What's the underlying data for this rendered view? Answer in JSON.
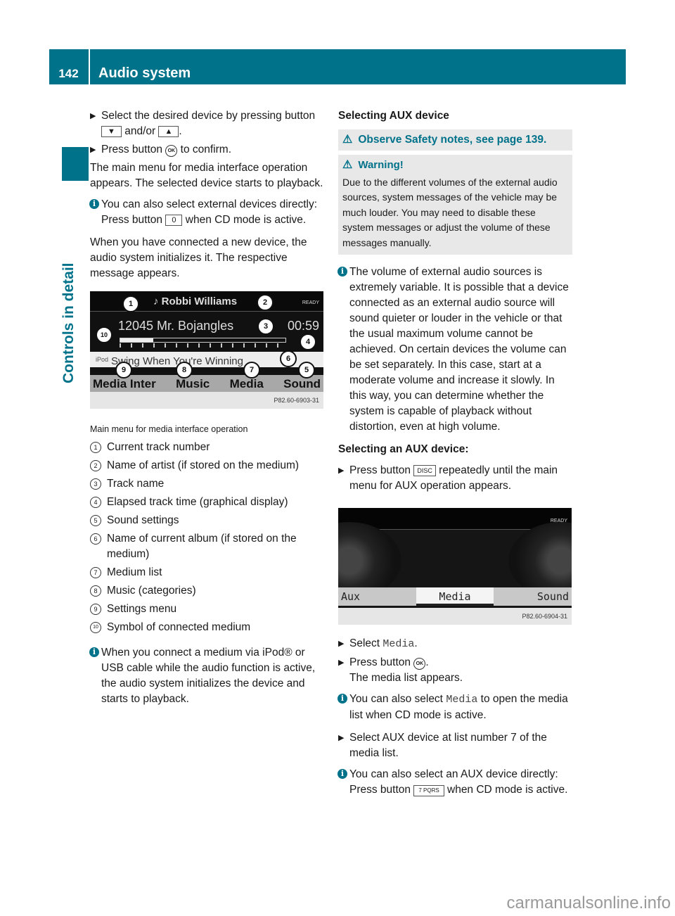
{
  "header": {
    "page_number": "142",
    "title": "Audio system"
  },
  "sidebar": {
    "section": "Controls in detail"
  },
  "left": {
    "steps_1": [
      {
        "pre": "Select the desired device by pressing button",
        "key1": "▼",
        "mid": "and/or",
        "key2": "▲",
        "post": "."
      },
      {
        "pre": "Press button",
        "key": "OK",
        "post": "to confirm."
      }
    ],
    "para_1": "The main menu for media interface operation appears. The selected device starts to playback.",
    "info_1": {
      "pre": "You can also select external devices directly: Press button",
      "key": "0",
      "post": "when CD mode is active."
    },
    "para_2": "When you have connected a new device, the audio system initializes it. The respective message appears.",
    "figure": {
      "artist": "Robbi Williams",
      "ready_label": "READY",
      "track": "12045  Mr. Bojangles",
      "time": "00:59",
      "progress_fraction": 0.2,
      "source": "iPod",
      "album": "Swing When You're Winning",
      "menu": [
        "Media Inter",
        "Music",
        "Media",
        "Sound"
      ],
      "code": "P82.60-6903-31",
      "callouts": [
        "1",
        "2",
        "3",
        "4",
        "5",
        "6",
        "7",
        "8",
        "9",
        "10"
      ]
    },
    "caption": "Main menu for media interface operation",
    "legend": [
      {
        "num": "1",
        "text": "Current track number"
      },
      {
        "num": "2",
        "text": "Name of artist (if stored on the medium)"
      },
      {
        "num": "3",
        "text": "Track name"
      },
      {
        "num": "4",
        "text": "Elapsed track time (graphical display)"
      },
      {
        "num": "5",
        "text": "Sound settings"
      },
      {
        "num": "6",
        "text": "Name of current album (if stored on the medium)"
      },
      {
        "num": "7",
        "text": "Medium list"
      },
      {
        "num": "8",
        "text": "Music (categories)"
      },
      {
        "num": "9",
        "text": "Settings menu"
      },
      {
        "num": "10",
        "text": "Symbol of connected medium"
      }
    ],
    "info_2": "When you connect a medium via iPod® or USB cable while the audio function is active, the audio system initializes the device and starts to playback."
  },
  "right": {
    "heading_1": "Selecting AUX device",
    "caution": "Observe Safety notes, see page 139.",
    "warning_title": "Warning!",
    "warning_text": "Due to the different volumes of the external audio sources, system messages of the vehicle may be much louder. You may need to disable these system messages or adjust the volume of these messages manually.",
    "info_1": "The volume of external audio sources is extremely variable. It is possible that a device connected as an external audio source will sound quieter or louder in the vehicle or that the usual maximum volume cannot be achieved. On certain devices the volume can be set separately. In this case, start at a moderate volume and increase it slowly. In this way, you can determine whether the system is capable of playback without distortion, even at high volume.",
    "heading_2": "Selecting an AUX device:",
    "step_disc": {
      "pre": "Press button",
      "key": "DISC",
      "post": "repeatedly until the main menu for AUX operation appears."
    },
    "figure": {
      "ready_label": "READY",
      "menu": [
        "Aux",
        "Media",
        "Sound"
      ],
      "selected": "Media",
      "code": "P82.60-6904-31"
    },
    "step_media": {
      "pre": "Select",
      "mono": "Media",
      "post": "."
    },
    "step_ok": {
      "pre": "Press button",
      "key": "OK",
      "post": ".",
      "result": "The media list appears."
    },
    "info_2": {
      "pre": "You can also select",
      "mono": "Media",
      "post": "to open the media list when CD mode is active."
    },
    "step_aux": "Select AUX device at list number 7 of the media list.",
    "info_3": {
      "pre": "You can also select an AUX device directly: Press button",
      "key": "7 PQRS",
      "post": "when CD mode is active."
    }
  },
  "watermark": "carmanualsonline.info",
  "colors": {
    "accent": "#00728a",
    "box": "#e8e8e8"
  }
}
